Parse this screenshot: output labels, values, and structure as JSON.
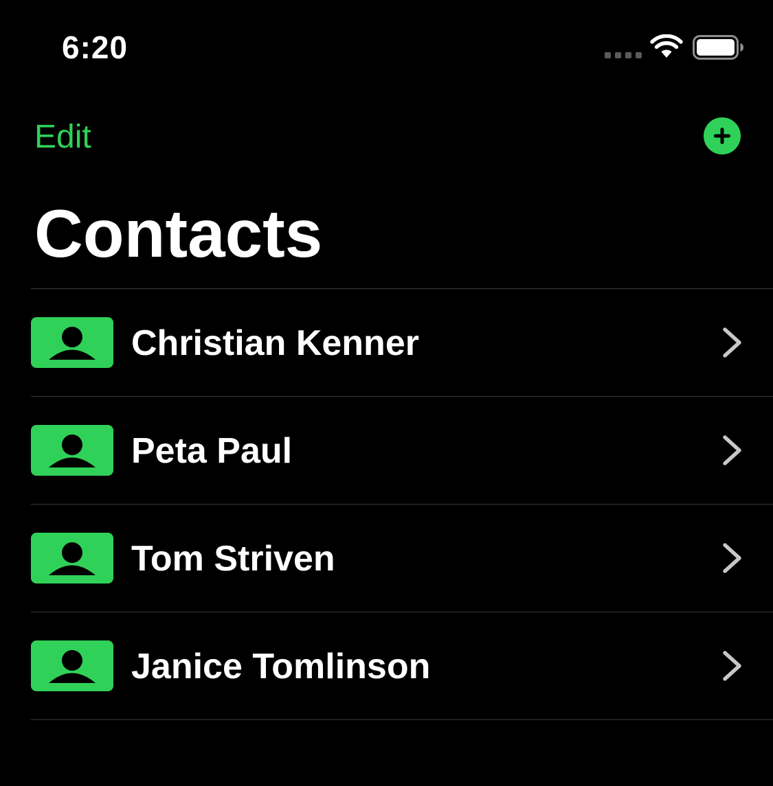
{
  "status_bar": {
    "time": "6:20"
  },
  "nav": {
    "edit_label": "Edit",
    "title": "Contacts"
  },
  "contacts": [
    {
      "name": "Christian Kenner"
    },
    {
      "name": "Peta Paul"
    },
    {
      "name": "Tom Striven"
    },
    {
      "name": "Janice Tomlinson"
    }
  ],
  "icons": {
    "signal": "cellular-signal-icon",
    "wifi": "wifi-icon",
    "battery": "battery-icon",
    "add": "plus-circle-icon",
    "avatar": "person-card-icon",
    "chevron": "chevron-right-icon"
  },
  "colors": {
    "accent": "#30d158",
    "background": "#000000",
    "separator": "#3a3a3c",
    "chevron": "#c7c7cc"
  }
}
